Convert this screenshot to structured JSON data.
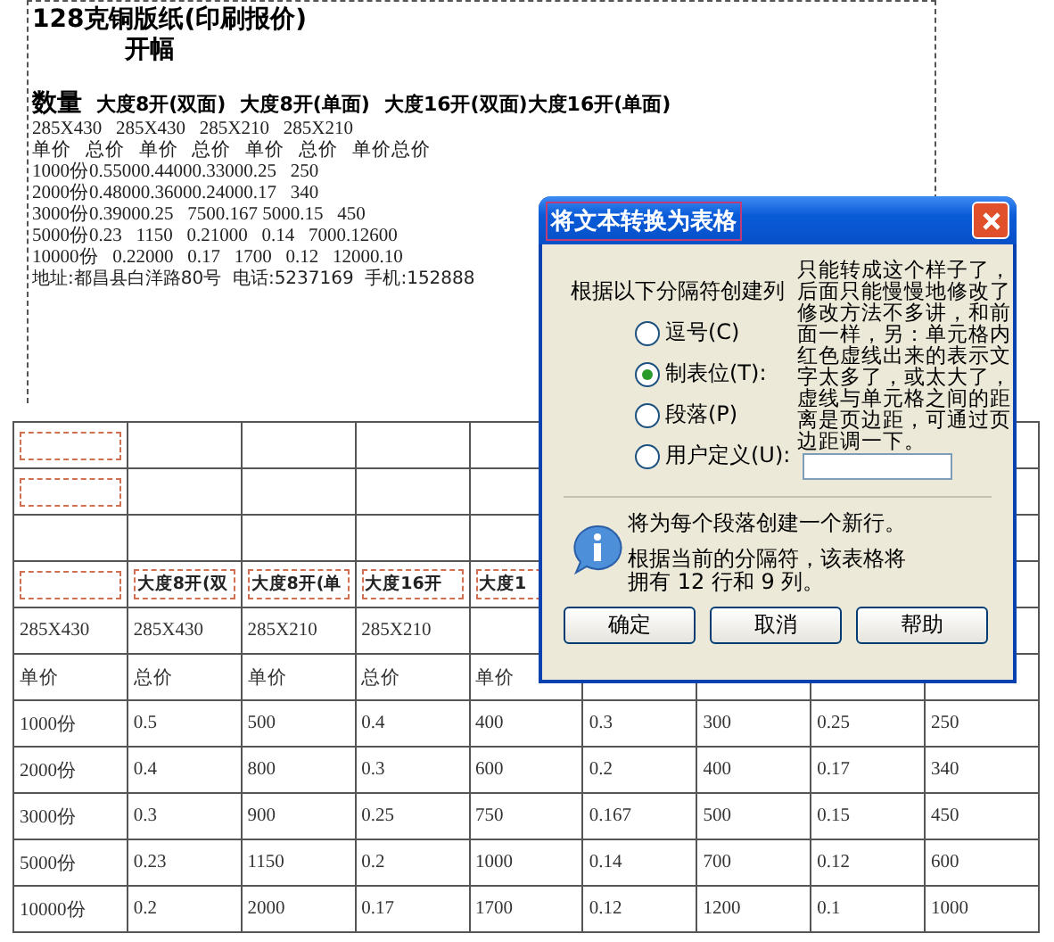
{
  "price_sheet": {
    "title": "128克铜版纸(印刷报价)",
    "subtitle": "开幅",
    "header": [
      "数量",
      "大度8开(双面)",
      "大度8开(单面)",
      "大度16开(双面)大度16开(单面)"
    ],
    "lines": [
      "285X430   285X430   285X210   285X210",
      "单价   总价   单价   总价   单价   总价   单价总价",
      "1000份0.55000.44000.33000.25   250",
      "2000份0.48000.36000.24000.17   340",
      "3000份0.39000.25   7500.167 5000.15   450",
      "5000份0.23   1150   0.21000   0.14   7000.12600",
      "10000份   0.22000   0.17   1700   0.12   12000.10"
    ],
    "address": "地址:都昌县白洋路80号  电话:5237169  手机:152888"
  },
  "table": {
    "rows": [
      {
        "first_mark": true,
        "cells": []
      },
      {
        "first_mark": true,
        "cells": []
      },
      {
        "first_mark": false,
        "cells": []
      },
      {
        "first_mark": true,
        "cell_marks": true,
        "cells": [
          "大度8开(双",
          "大度8开(单",
          "大度16开",
          "大度1"
        ]
      },
      {
        "first_mark": false,
        "cell_marks": false,
        "label": "285X430",
        "cells": [
          "285X430",
          "285X210",
          "285X210"
        ]
      },
      {
        "first_mark": false,
        "cell_marks": false,
        "label": "单价",
        "cells": [
          "总价",
          "单价",
          "总价",
          "单价"
        ]
      },
      {
        "first_mark": false,
        "cell_marks": false,
        "label": "1000份",
        "cells": [
          "0.5",
          "500",
          "0.4",
          "400",
          "0.3",
          "300",
          "0.25",
          "250"
        ]
      },
      {
        "first_mark": false,
        "cell_marks": false,
        "label": "2000份",
        "cells": [
          "0.4",
          "800",
          "0.3",
          "600",
          "0.2",
          "400",
          "0.17",
          "340"
        ]
      },
      {
        "first_mark": false,
        "cell_marks": false,
        "label": "3000份",
        "cells": [
          "0.3",
          "900",
          "0.25",
          "750",
          "0.167",
          "500",
          "0.15",
          "450"
        ]
      },
      {
        "first_mark": false,
        "cell_marks": false,
        "label": "5000份",
        "cells": [
          "0.23",
          "1150",
          "0.2",
          "1000",
          "0.14",
          "700",
          "0.12",
          "600"
        ]
      },
      {
        "first_mark": false,
        "cell_marks": false,
        "label": "10000份",
        "cells": [
          "0.2",
          "2000",
          "0.17",
          "1700",
          "0.12",
          "1200",
          "0.1",
          "1000"
        ]
      }
    ]
  },
  "dialog": {
    "title": "将文本转换为表格",
    "prompt": "根据以下分隔符创建列",
    "options": [
      {
        "label": "逗号(C)",
        "selected": false
      },
      {
        "label": "制表位(T):",
        "selected": true
      },
      {
        "label": "段落(P)",
        "selected": false
      },
      {
        "label": "用户定义(U):",
        "selected": false,
        "has_field": true
      }
    ],
    "note": "只能转成这个样子了，后面只能慢慢地修改了修改方法不多讲，和前面一样，另：单元格内红色虚线出来的表示文字太多了，或太大了，虚线与单元格之间的距离是页边距，可通过页边距调一下。",
    "info_lines": [
      "将为每个段落创建一个新行。",
      "根据当前的分隔符，该表格将拥有 12 行和 9 列。"
    ],
    "buttons": [
      "确定",
      "取消",
      "帮助"
    ]
  }
}
